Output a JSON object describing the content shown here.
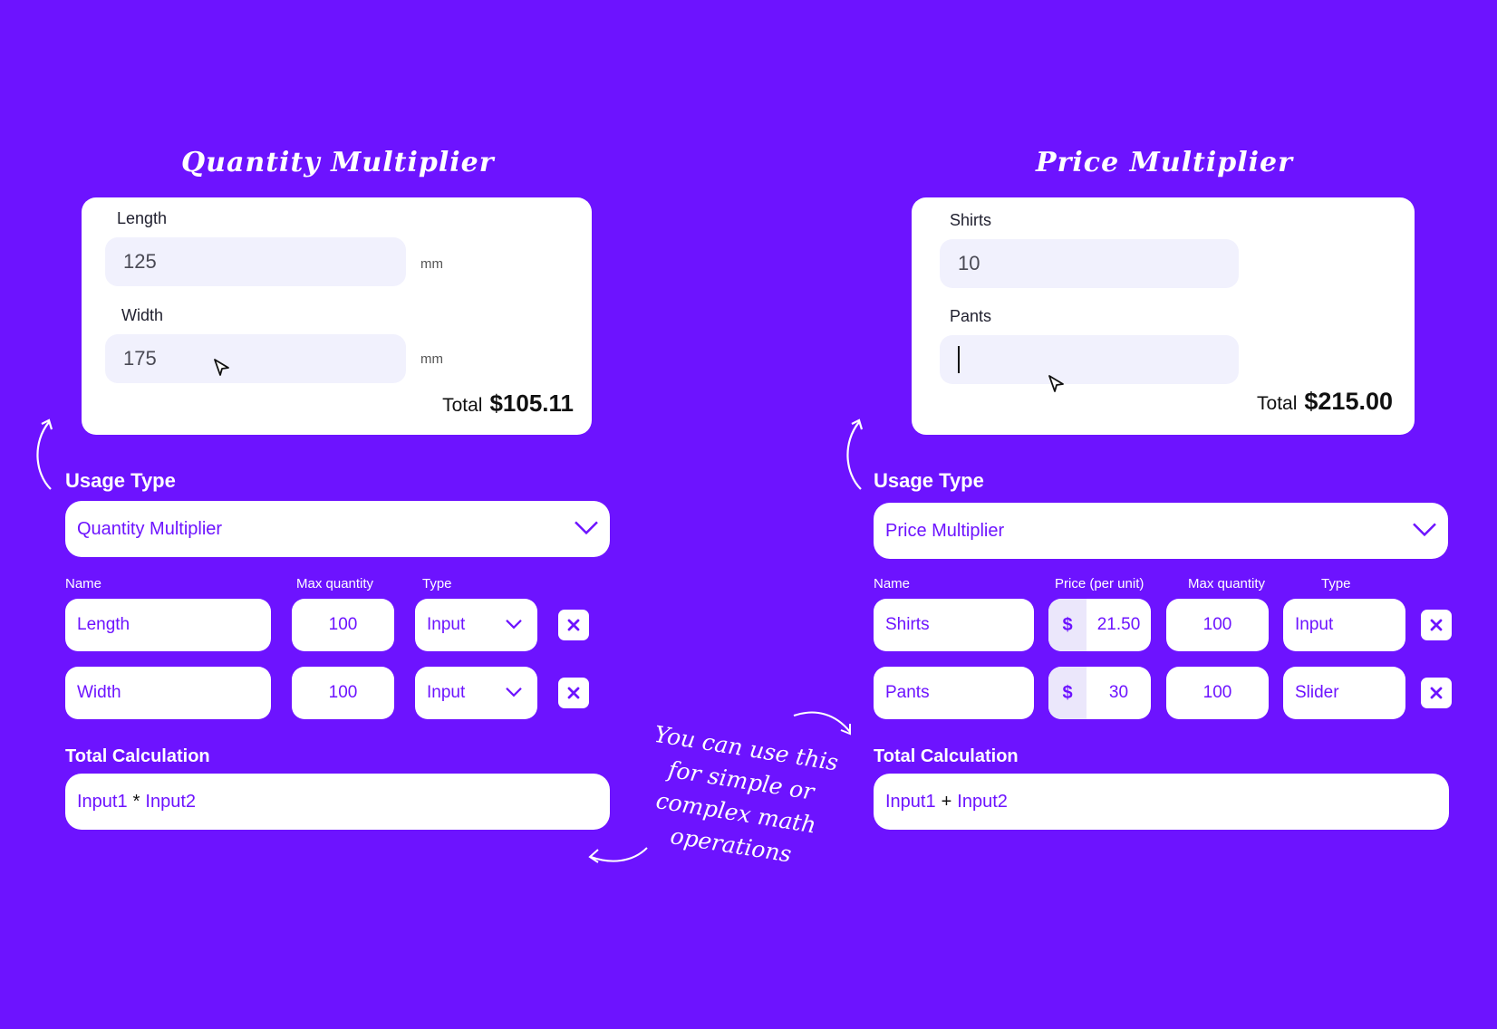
{
  "left": {
    "heading": "Quantity Multiplier",
    "preview": {
      "fields": [
        {
          "label": "Length",
          "value": "125",
          "unit": "mm"
        },
        {
          "label": "Width",
          "value": "175",
          "unit": "mm"
        }
      ],
      "total_label": "Total",
      "total_value": "$105.11"
    },
    "usage_label": "Usage Type",
    "usage_value": "Quantity Multiplier",
    "columns": {
      "name": "Name",
      "max_quantity": "Max quantity",
      "type": "Type"
    },
    "rows": [
      {
        "name": "Length",
        "max": "100",
        "type": "Input"
      },
      {
        "name": "Width",
        "max": "100",
        "type": "Input"
      }
    ],
    "total_calc_label": "Total Calculation",
    "formula": {
      "a": "Input1",
      "op": "*",
      "b": "Input2"
    }
  },
  "right": {
    "heading": "Price Multiplier",
    "preview": {
      "fields": [
        {
          "label": "Shirts",
          "value": "10"
        },
        {
          "label": "Pants",
          "value": ""
        }
      ],
      "total_label": "Total",
      "total_value": "$215.00"
    },
    "usage_label": "Usage Type",
    "usage_value": "Price Multiplier",
    "columns": {
      "name": "Name",
      "price": "Price (per unit)",
      "max_quantity": "Max quantity",
      "type": "Type"
    },
    "rows": [
      {
        "name": "Shirts",
        "currency": "$",
        "price": "21.50",
        "max": "100",
        "type": "Input"
      },
      {
        "name": "Pants",
        "currency": "$",
        "price": "30",
        "max": "100",
        "type": "Slider"
      }
    ],
    "total_calc_label": "Total Calculation",
    "formula": {
      "a": "Input1",
      "op": "+",
      "b": "Input2"
    }
  },
  "note": {
    "line1": "You can use this",
    "line2": "for simple or",
    "line3": "complex math",
    "line4": "operations"
  },
  "colors": {
    "background": "#6d13ff",
    "accent": "#6d13ff",
    "field": "#f1f1fd"
  }
}
